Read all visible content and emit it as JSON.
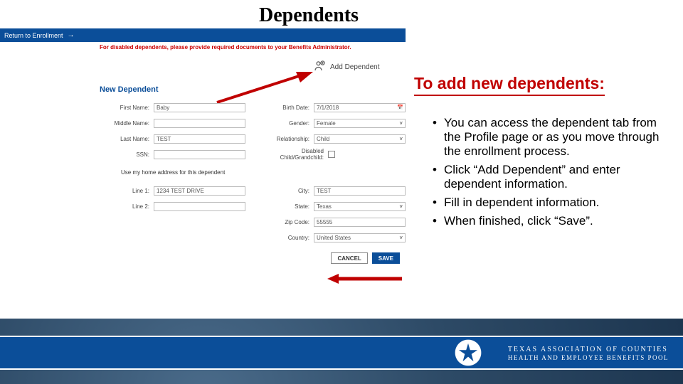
{
  "title": "Dependents",
  "return_bar": "Return to Enrollment",
  "disabled_note": "For disabled dependents, please provide required documents to your Benefits Administrator.",
  "add_dependent_label": "Add Dependent",
  "form": {
    "heading": "New Dependent",
    "left": {
      "first_name": {
        "label": "First Name:",
        "value": "Baby"
      },
      "middle_name": {
        "label": "Middle Name:",
        "value": ""
      },
      "last_name": {
        "label": "Last Name:",
        "value": "TEST"
      },
      "ssn": {
        "label": "SSN:",
        "value": ""
      }
    },
    "right": {
      "birth_date": {
        "label": "Birth Date:",
        "value": "7/1/2018"
      },
      "gender": {
        "label": "Gender:",
        "value": "Female"
      },
      "relationship": {
        "label": "Relationship:",
        "value": "Child"
      },
      "disabled": {
        "label": "Disabled Child/Grandchild:"
      }
    },
    "use_home_addr": "Use my home address for this dependent",
    "addr": {
      "line1": {
        "label": "Line 1:",
        "value": "1234 TEST DRIVE"
      },
      "line2": {
        "label": "Line 2:",
        "value": ""
      },
      "city": {
        "label": "City:",
        "value": "TEST"
      },
      "state": {
        "label": "State:",
        "value": "Texas"
      },
      "zip": {
        "label": "Zip Code:",
        "value": "55555"
      },
      "country": {
        "label": "Country:",
        "value": "United States"
      }
    },
    "cancel": "CANCEL",
    "save": "SAVE"
  },
  "instr": {
    "heading": "To add new dependents:",
    "items": [
      "You can access the dependent tab from the Profile page or as you move through the enrollment process.",
      "Click “Add Dependent” and enter dependent information.",
      "Fill in dependent information.",
      "When finished, click “Save”."
    ]
  },
  "footer": {
    "line1": "TEXAS ASSOCIATION OF COUNTIES",
    "line2": "HEALTH AND EMPLOYEE BENEFITS POOL"
  }
}
